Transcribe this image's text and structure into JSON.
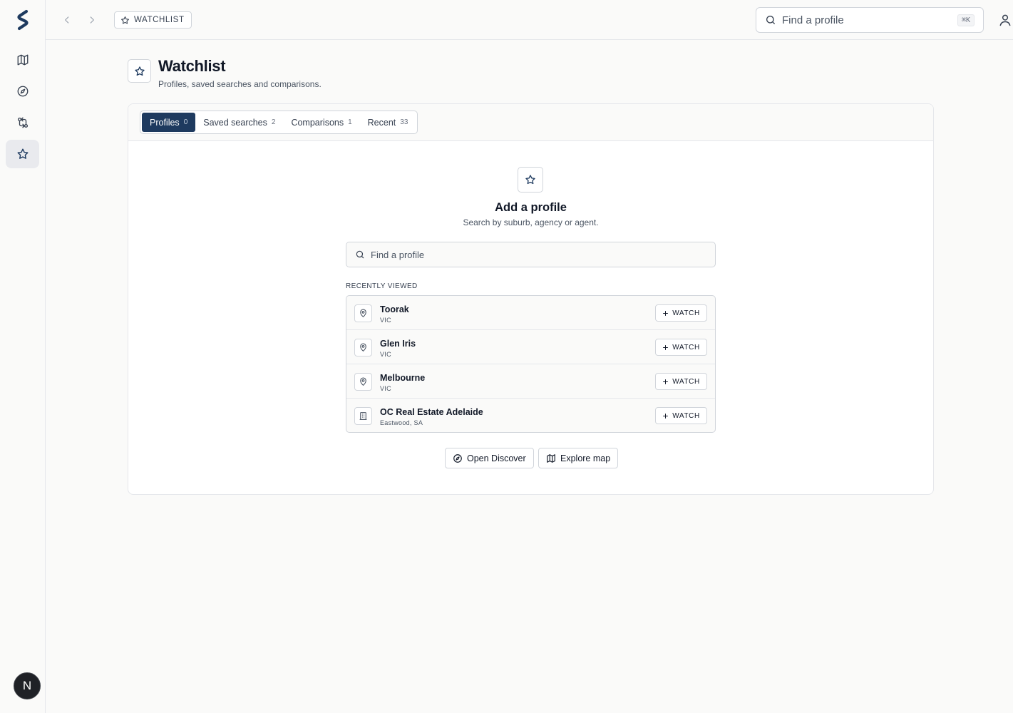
{
  "sidebar": {
    "logo": "logo-s",
    "items": [
      {
        "name": "map",
        "icon": "map-icon",
        "active": false
      },
      {
        "name": "discover",
        "icon": "compass-icon",
        "active": false
      },
      {
        "name": "compare",
        "icon": "compare-icon",
        "active": false
      },
      {
        "name": "watchlist",
        "icon": "star-icon",
        "active": true
      }
    ],
    "avatar_initial": "N"
  },
  "topbar": {
    "breadcrumb": "WATCHLIST",
    "search_placeholder": "Find a profile",
    "search_shortcut": "⌘K"
  },
  "page": {
    "title": "Watchlist",
    "subtitle": "Profiles, saved searches and comparisons."
  },
  "tabs": [
    {
      "label": "Profiles",
      "count": "0",
      "active": true
    },
    {
      "label": "Saved searches",
      "count": "2",
      "active": false
    },
    {
      "label": "Comparisons",
      "count": "1",
      "active": false
    },
    {
      "label": "Recent",
      "count": "33",
      "active": false
    }
  ],
  "empty_state": {
    "title": "Add a profile",
    "description": "Search by suburb, agency or agent.",
    "search_placeholder": "Find a profile",
    "recent_label": "RECENTLY VIEWED"
  },
  "recent": [
    {
      "name": "Toorak",
      "sub": "VIC",
      "icon": "pin-icon",
      "action": "WATCH"
    },
    {
      "name": "Glen Iris",
      "sub": "VIC",
      "icon": "pin-icon",
      "action": "WATCH"
    },
    {
      "name": "Melbourne",
      "sub": "VIC",
      "icon": "pin-icon",
      "action": "WATCH"
    },
    {
      "name": "OC Real Estate Adelaide",
      "sub": "Eastwood, SA",
      "icon": "building-icon",
      "action": "WATCH"
    }
  ],
  "actions": {
    "discover": "Open Discover",
    "map": "Explore map"
  },
  "colors": {
    "accent": "#1e3a5f",
    "border": "#d1d5db",
    "background": "#fafaf9"
  }
}
